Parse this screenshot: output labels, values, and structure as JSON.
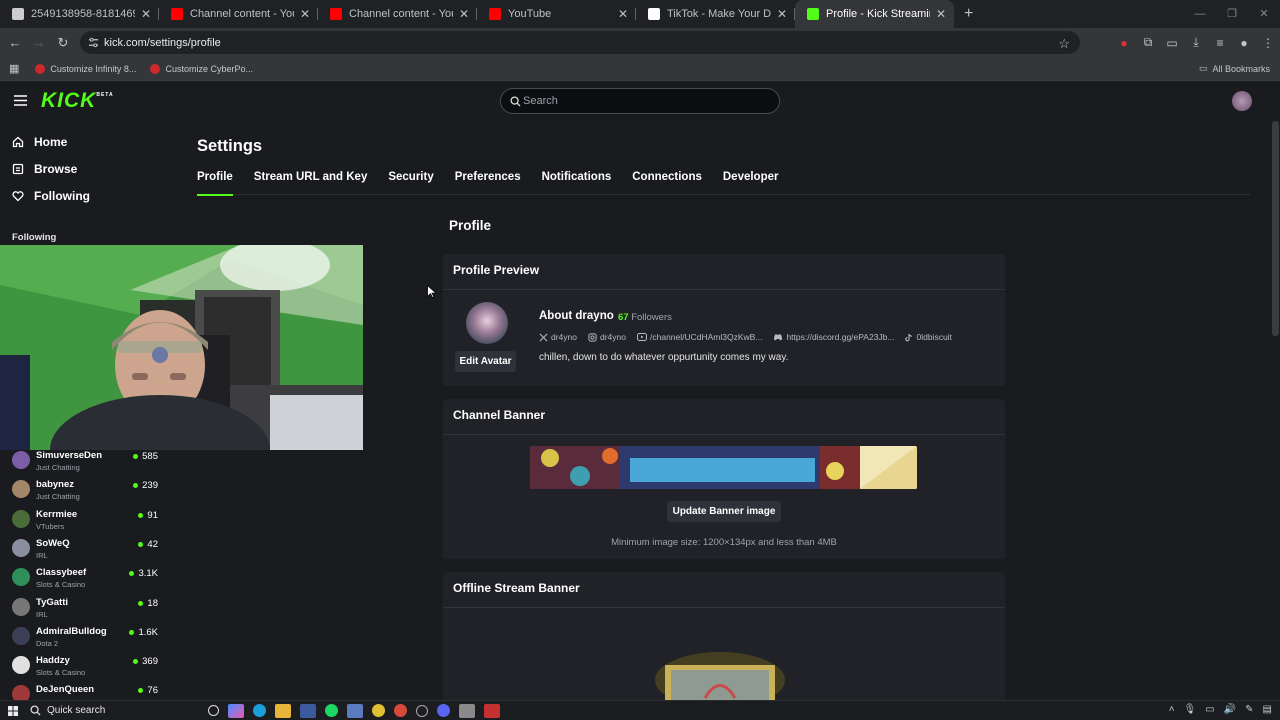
{
  "browser": {
    "tabs": [
      {
        "title": "2549138958-81814696-ca8af4...",
        "color": "#cccccc",
        "active": false
      },
      {
        "title": "Channel content - YouTube Stu...",
        "color": "#ff0000",
        "active": false
      },
      {
        "title": "Channel content - YouTube Stu...",
        "color": "#ff0000",
        "active": false
      },
      {
        "title": "YouTube",
        "color": "#ff0000",
        "active": false
      },
      {
        "title": "TikTok - Make Your Day",
        "color": "#ffffff",
        "active": false
      },
      {
        "title": "Profile - Kick Streaming",
        "color": "#53fc18",
        "active": true
      }
    ],
    "url": "kick.com/settings/profile",
    "bookmarks": [
      "Customize Infinity 8...",
      "Customize CyberPo..."
    ],
    "all_bookmarks": "All Bookmarks"
  },
  "header": {
    "logo": "KICK",
    "logo_badge": "BETA",
    "search_placeholder": "Search"
  },
  "sidebar": {
    "nav": [
      {
        "label": "Home",
        "icon": "home-icon"
      },
      {
        "label": "Browse",
        "icon": "browse-icon"
      },
      {
        "label": "Following",
        "icon": "heart-icon"
      }
    ],
    "following_label": "Following",
    "channels": [
      {
        "name": "SimuverseDen",
        "category": "Just Chatting",
        "viewers": "585",
        "color": "#7b5ea7"
      },
      {
        "name": "babynez",
        "category": "Just Chatting",
        "viewers": "239",
        "color": "#a3866a"
      },
      {
        "name": "Kerrmiee",
        "category": "VTubers",
        "viewers": "91",
        "color": "#4a6b3a"
      },
      {
        "name": "SoWeQ",
        "category": "IRL",
        "viewers": "42",
        "color": "#8a8fa0"
      },
      {
        "name": "Classybeef",
        "category": "Slots & Casino",
        "viewers": "3.1K",
        "color": "#2f8f5a"
      },
      {
        "name": "TyGatti",
        "category": "IRL",
        "viewers": "18",
        "color": "#777777"
      },
      {
        "name": "AdmiralBulldog",
        "category": "Dota 2",
        "viewers": "1.6K",
        "color": "#3a3f55"
      },
      {
        "name": "Haddzy",
        "category": "Slots & Casino",
        "viewers": "369",
        "color": "#e0e0e0"
      },
      {
        "name": "DeJenQueen",
        "category": "",
        "viewers": "76",
        "color": "#a03a3a"
      }
    ]
  },
  "settings": {
    "title": "Settings",
    "tabs": [
      "Profile",
      "Stream URL and Key",
      "Security",
      "Preferences",
      "Notifications",
      "Connections",
      "Developer"
    ],
    "active_tab": "Profile",
    "section_title": "Profile",
    "preview": {
      "heading": "Profile Preview",
      "edit_avatar": "Edit Avatar",
      "about": "About drayno",
      "followers_count": "67",
      "followers_label": "Followers",
      "socials": [
        {
          "icon": "x-icon",
          "text": "dr4yno"
        },
        {
          "icon": "instagram-icon",
          "text": "dr4yno"
        },
        {
          "icon": "youtube-icon",
          "text": "/channel/UCdHAml3QzKwB..."
        },
        {
          "icon": "discord-icon",
          "text": "https://discord.gg/ePA23Jb..."
        },
        {
          "icon": "tiktok-icon",
          "text": "0ldbiscuit"
        }
      ],
      "bio": "chillen, down to do whatever oppurtunity comes my way."
    },
    "banner": {
      "heading": "Channel Banner",
      "button": "Update Banner image",
      "note": "Minimum image size: 1200×134px and less than 4MB"
    },
    "offline": {
      "heading": "Offline Stream Banner"
    }
  },
  "taskbar": {
    "search": "Quick search"
  }
}
